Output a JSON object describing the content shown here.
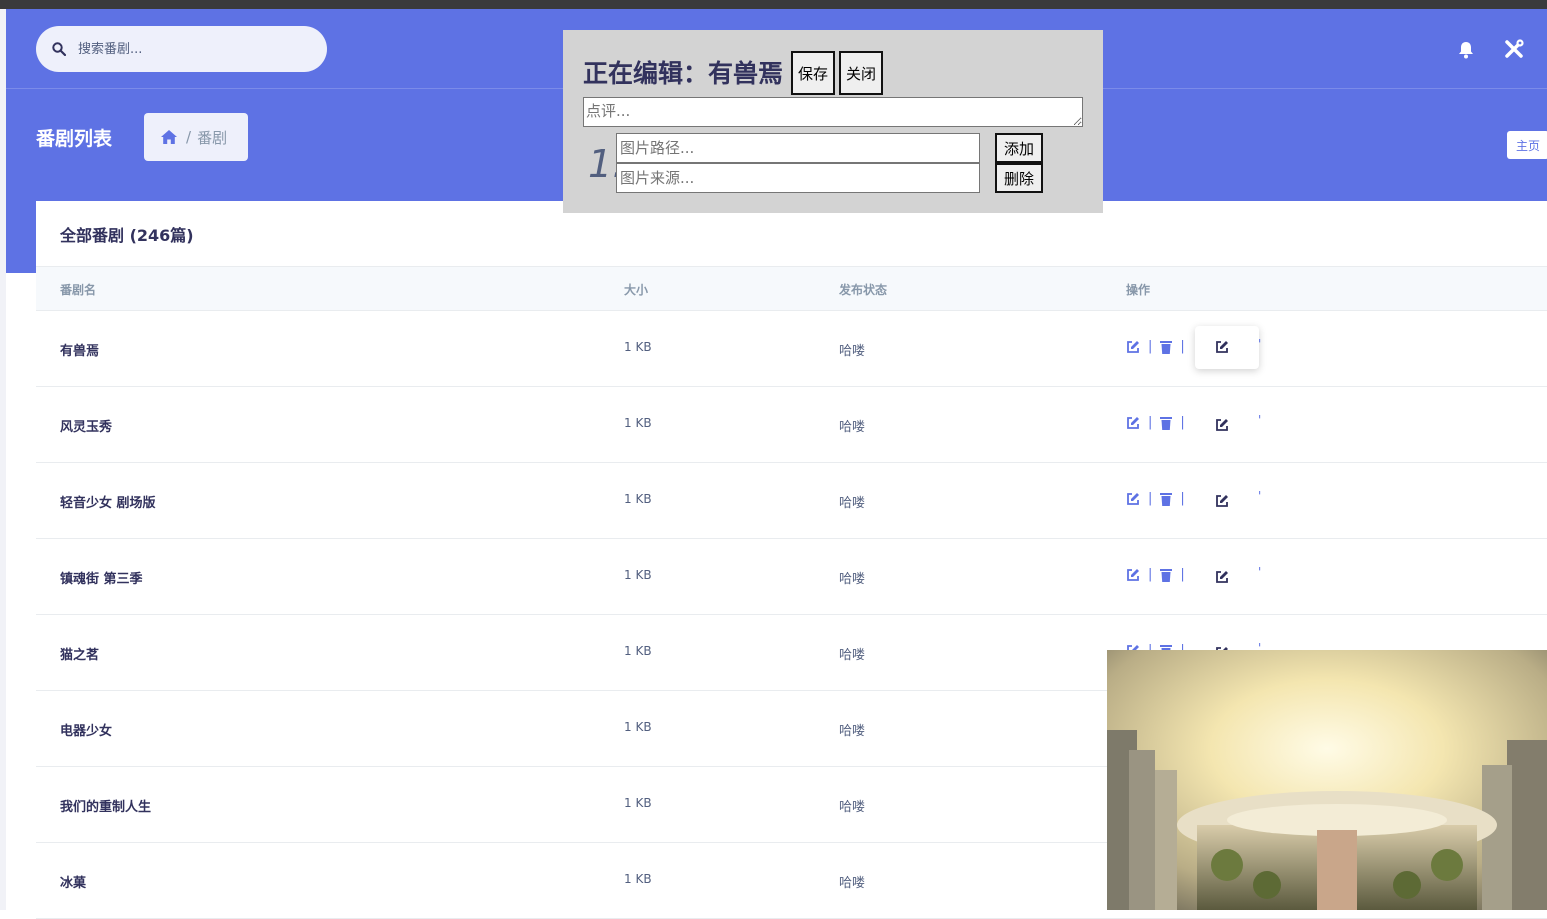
{
  "search": {
    "placeholder": "搜索番剧..."
  },
  "header": {
    "page_title": "番剧列表",
    "breadcrumb_current": "番剧",
    "breadcrumb_sep": "/",
    "home_button": "主页"
  },
  "card": {
    "title": "全部番剧 (246篇)",
    "columns": [
      "番剧名",
      "大小",
      "发布状态",
      "操作"
    ],
    "rows": [
      {
        "name": "有兽焉",
        "size": "1 KB",
        "status": "哈喽"
      },
      {
        "name": "风灵玉秀",
        "size": "1 KB",
        "status": "哈喽"
      },
      {
        "name": "轻音少女 剧场版",
        "size": "1 KB",
        "status": "哈喽"
      },
      {
        "name": "镇魂街 第三季",
        "size": "1 KB",
        "status": "哈喽"
      },
      {
        "name": "猫之茗",
        "size": "1 KB",
        "status": "哈喽"
      },
      {
        "name": "电器少女",
        "size": "1 KB",
        "status": "哈喽"
      },
      {
        "name": "我们的重制人生",
        "size": "1 KB",
        "status": "哈喽"
      },
      {
        "name": "冰菓",
        "size": "1 KB",
        "status": "哈喽"
      }
    ],
    "op_separator": "|",
    "op_tick": "'"
  },
  "editor": {
    "heading": "正在编辑：有兽焉",
    "save_label": "保存",
    "close_label": "关闭",
    "comment_placeholder": "点评...",
    "image_index": "1.",
    "image_path_placeholder": "图片路径...",
    "image_source_placeholder": "图片来源...",
    "add_label": "添加",
    "delete_label": "删除"
  },
  "icons": {
    "search": "search-icon",
    "bell": "bell-icon",
    "tools": "tools-icon",
    "home": "home-icon",
    "edit": "edit-icon",
    "trash": "trash-icon"
  },
  "colors": {
    "primary": "#5e72e4",
    "heading": "#32325d",
    "muted": "#8898aa",
    "editor_bg": "#d3d3d3"
  }
}
